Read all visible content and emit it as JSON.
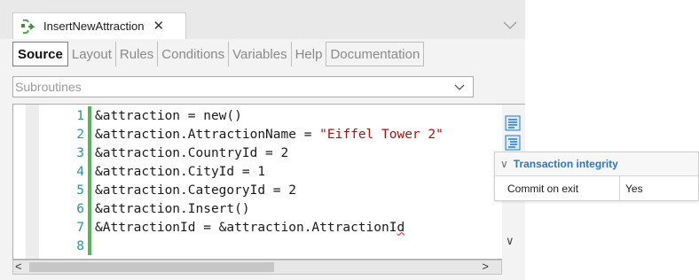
{
  "document_tab": {
    "title": "InsertNewAttraction",
    "close_glyph": "✕",
    "icon": "transaction-icon"
  },
  "subtabs": [
    "Source",
    "Layout",
    "Rules",
    "Conditions",
    "Variables",
    "Help",
    "Documentation"
  ],
  "active_subtab": "Source",
  "subroutines": {
    "value": "Subroutines"
  },
  "code_lines": [
    {
      "n": "1",
      "parts": [
        {
          "t": "&attraction = new()"
        }
      ]
    },
    {
      "n": "2",
      "parts": [
        {
          "t": "&attraction.AttractionName = "
        },
        {
          "t": "\"Eiffel Tower 2\"",
          "c": "str"
        }
      ]
    },
    {
      "n": "3",
      "parts": [
        {
          "t": "&attraction.CountryId = 2"
        }
      ]
    },
    {
      "n": "4",
      "parts": [
        {
          "t": "&attraction.CityId = 1"
        }
      ]
    },
    {
      "n": "5",
      "parts": [
        {
          "t": "&attraction.CategoryId = 2"
        }
      ]
    },
    {
      "n": "6",
      "parts": [
        {
          "t": "&attraction.Insert()"
        }
      ]
    },
    {
      "n": "7",
      "parts": [
        {
          "t": "&AttractionId = &attraction.AttractionI"
        },
        {
          "t": "d",
          "c": "squig"
        }
      ]
    },
    {
      "n": "8",
      "parts": [
        {
          "t": ""
        }
      ]
    }
  ],
  "properties": {
    "category": "Transaction integrity",
    "rows": [
      {
        "name": "Commit on exit",
        "value": "Yes"
      }
    ]
  },
  "scrollbar": {
    "left_arrow": "<",
    "right_arrow": ">",
    "down_arrow": "∨"
  },
  "colors": {
    "line_number": "#2b91af",
    "string": "#a31515",
    "changebar": "#57b45a",
    "category_title": "#2b77c5"
  }
}
